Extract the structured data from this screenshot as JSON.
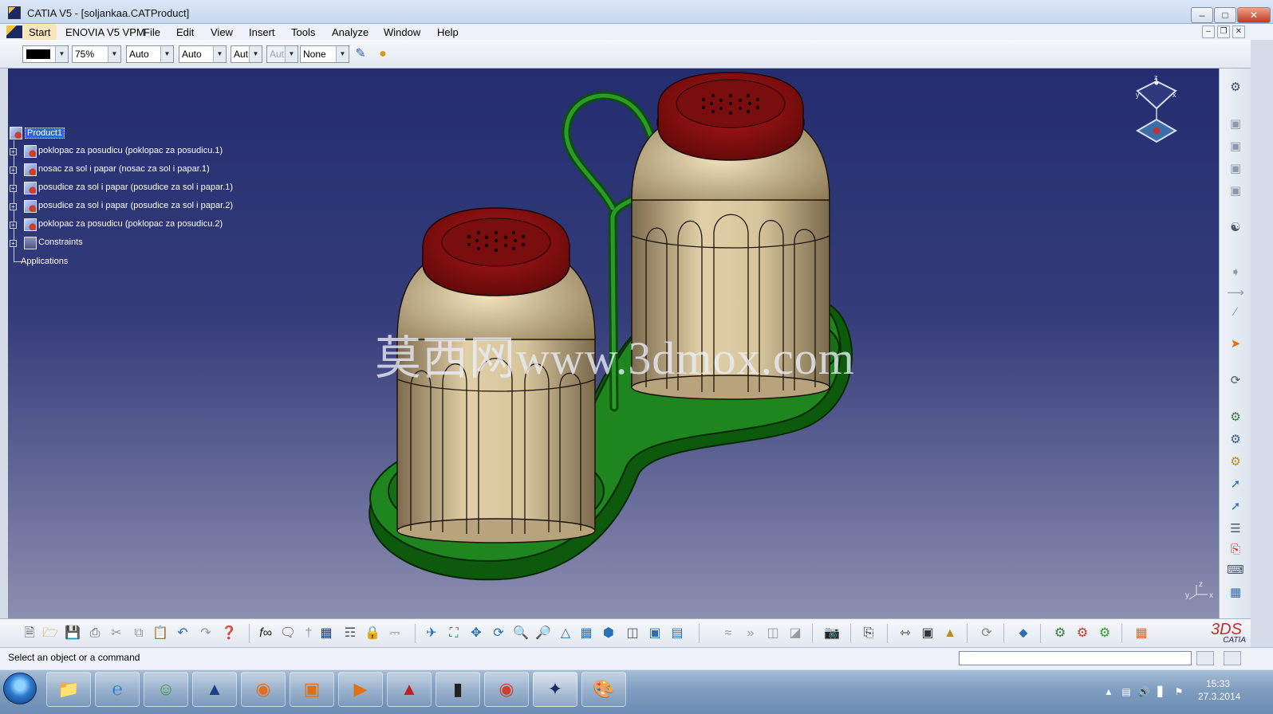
{
  "window": {
    "title": "CATIA V5 - [soljankaa.CATProduct]",
    "controls": {
      "minimize": "–",
      "maximize": "□",
      "close": "✕"
    }
  },
  "menu": {
    "items": [
      "Start",
      "ENOVIA V5 VPM",
      "File",
      "Edit",
      "View",
      "Insert",
      "Tools",
      "Analyze",
      "Window",
      "Help"
    ],
    "mdi_controls": {
      "minimize": "–",
      "restore": "❐",
      "close": "✕"
    }
  },
  "graphic_properties_toolbar": {
    "color": "#000000",
    "transparency": "75%",
    "line_thickness": "Auto",
    "line_type": "Auto",
    "point_symbol": "Aut",
    "rendering_style": "Aut",
    "layer": "None"
  },
  "spec_tree": {
    "root": "Product1",
    "children": [
      "poklopac za posudicu (poklopac za posudicu.1)",
      "nosac za sol i papar (nosac za sol i papar.1)",
      "posudice za sol i papar (posudice za sol i papar.1)",
      "posudice za sol i papar (posudice za sol i papar.2)",
      "poklopac za posudicu (poklopac za posudicu.2)",
      "Constraints"
    ],
    "applications": "Applications"
  },
  "compass": {
    "x": "x",
    "y": "y",
    "z": "z"
  },
  "watermark": "莫西网www.3dmox.com",
  "viewport_axis": {
    "x": "x",
    "y": "y",
    "z": "z"
  },
  "brand": {
    "word": "CATIA",
    "mark": "3DS"
  },
  "status": {
    "prompt": "Select an object or a command"
  },
  "taskbar": {
    "apps": [
      "Windows Explorer",
      "Internet Explorer",
      "Windows Live Messenger",
      "Autodesk Revit",
      "Firefox",
      "Autodesk Inventor",
      "Media Player",
      "AutoCAD",
      "SolidWorks",
      "Chrome",
      "CATIA",
      "Paint"
    ],
    "clock_time": "15:33",
    "clock_date": "27.3.2014"
  },
  "colors": {
    "viewport_top": "#242d6f",
    "viewport_bottom": "#8d8fb0",
    "holder_green": "#1c7a1c",
    "cap_red": "#8a1010",
    "shaker_body": "#cbb58a"
  }
}
